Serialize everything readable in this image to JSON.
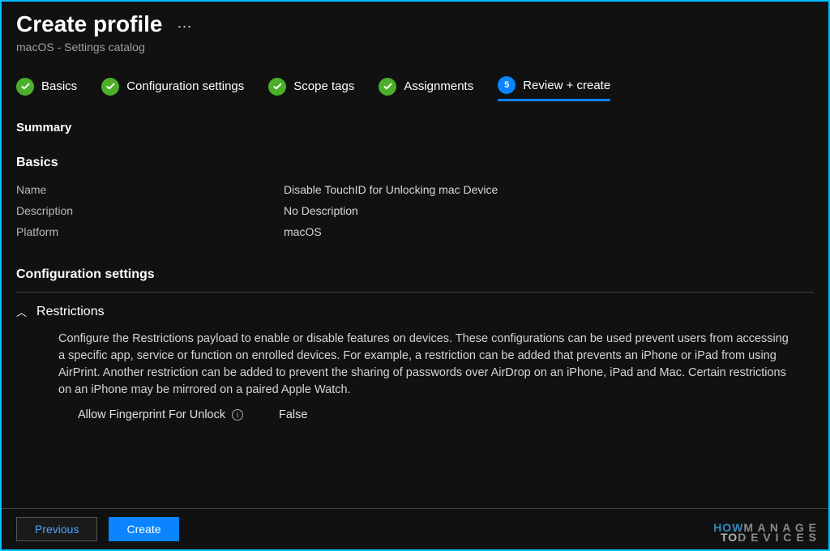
{
  "header": {
    "title": "Create profile",
    "subtitle": "macOS - Settings catalog"
  },
  "steps": {
    "s1": "Basics",
    "s2": "Configuration settings",
    "s3": "Scope tags",
    "s4": "Assignments",
    "s5_num": "5",
    "s5": "Review + create"
  },
  "summary_label": "Summary",
  "basics": {
    "heading": "Basics",
    "name_key": "Name",
    "name_val": "Disable TouchID for Unlocking mac Device",
    "desc_key": "Description",
    "desc_val": "No Description",
    "plat_key": "Platform",
    "plat_val": "macOS"
  },
  "config": {
    "heading": "Configuration settings",
    "section_title": "Restrictions",
    "section_desc": "Configure the Restrictions payload to enable or disable features on devices. These configurations can be used prevent users from accessing a specific app, service or function on enrolled devices. For example, a restriction can be added that prevents an iPhone or iPad from using AirPrint. Another restriction can be added to prevent the sharing of passwords over AirDrop on an iPhone, iPad and Mac. Certain restrictions on an iPhone may be mirrored on a paired Apple Watch.",
    "setting_label": "Allow Fingerprint For Unlock",
    "setting_value": "False"
  },
  "footer": {
    "prev": "Previous",
    "create": "Create"
  },
  "watermark": {
    "how": "HOW",
    "to": "TO",
    "manage": "M A N A G E",
    "devices": "D E V I C E S"
  }
}
